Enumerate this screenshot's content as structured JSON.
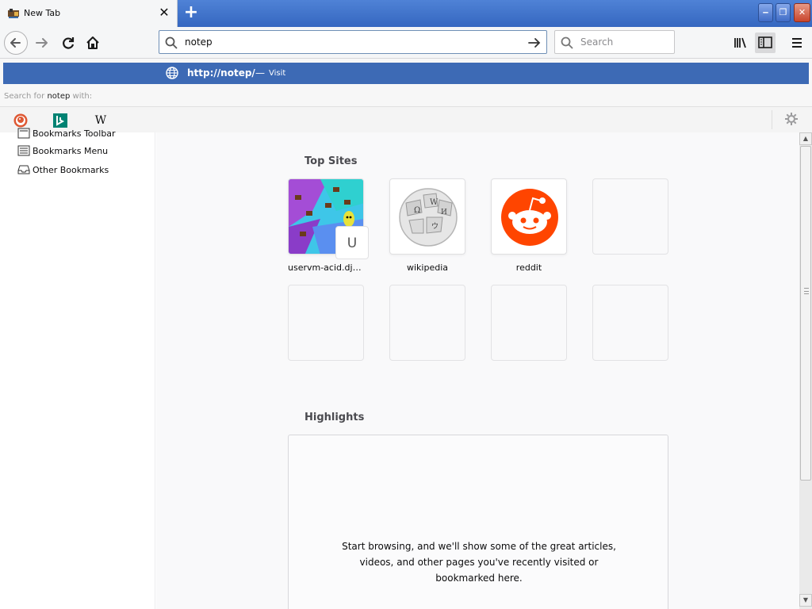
{
  "tab": {
    "title": "New Tab",
    "close": "✕",
    "new_tab": "+"
  },
  "window_controls": {
    "minimize": "‒",
    "maximize": "❐",
    "close": "✕"
  },
  "urlbar": {
    "value": "notep"
  },
  "searchbar": {
    "placeholder": "Search"
  },
  "popup": {
    "visit_url": "http://notep/",
    "dash": "—",
    "visit_label": "Visit",
    "search_for_prefix": "Search for ",
    "search_for_term": "notep",
    "search_for_suffix": " with:",
    "engines": [
      "duckduckgo-icon",
      "bing-icon",
      "wikipedia-icon"
    ],
    "wiki_glyph": "W"
  },
  "sidebar": {
    "items": [
      {
        "label": "Bookmarks Toolbar"
      },
      {
        "label": "Bookmarks Menu"
      },
      {
        "label": "Other Bookmarks"
      }
    ]
  },
  "topsites": {
    "title": "Top Sites",
    "tiles": [
      {
        "label": "uservm-acid.djpar..."
      },
      {
        "label": "wikipedia"
      },
      {
        "label": "reddit"
      }
    ],
    "badge_letter": "U"
  },
  "highlights": {
    "title": "Highlights",
    "empty_text_1": "Start browsing, and we'll show some of the great articles,",
    "empty_text_2": "videos, and other pages you've recently visited or",
    "empty_text_3": "bookmarked here."
  },
  "colors": {
    "tab_strip": "#3f6fc4",
    "popup_selected": "#3d6ab5",
    "reddit": "#ff4500"
  }
}
